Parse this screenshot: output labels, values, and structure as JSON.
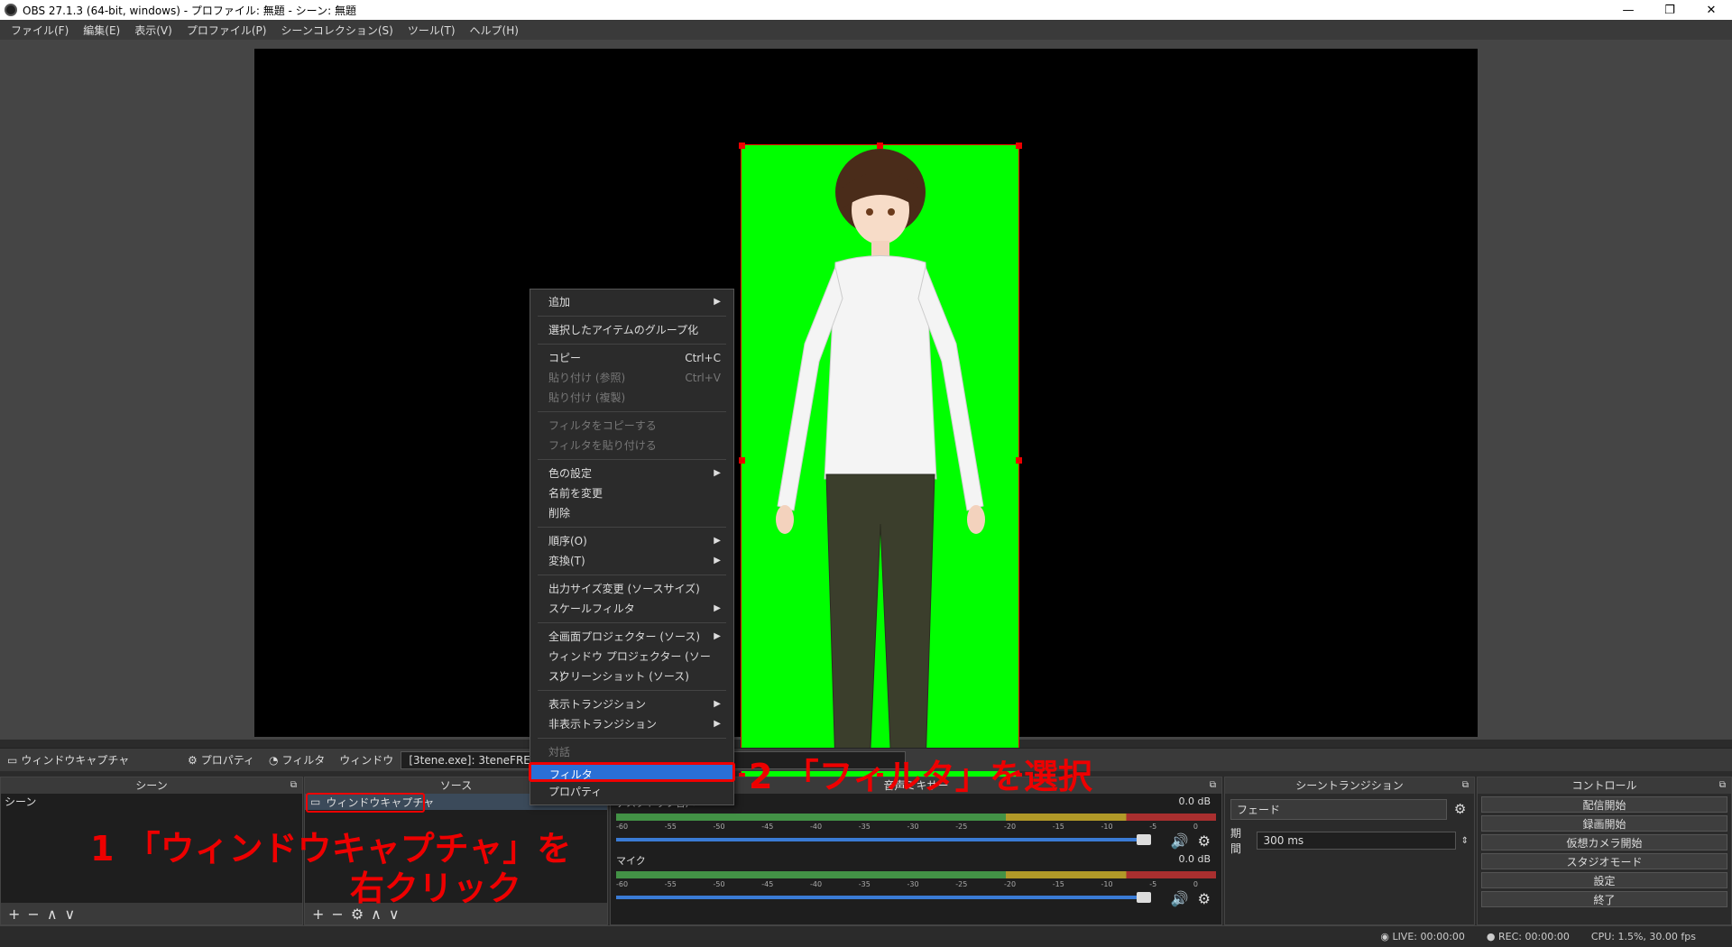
{
  "window": {
    "title": "OBS 27.1.3 (64-bit, windows) - プロファイル: 無題 - シーン: 無題",
    "minimize": "—",
    "maximize": "❐",
    "close": "✕"
  },
  "menubar": [
    "ファイル(F)",
    "編集(E)",
    "表示(V)",
    "プロファイル(P)",
    "シーンコレクション(S)",
    "ツール(T)",
    "ヘルプ(H)"
  ],
  "source_toolbar": {
    "source_name": "ウィンドウキャプチャ",
    "properties": "プロパティ",
    "filters": "フィルタ",
    "window_label": "ウィンドウ",
    "window_value": "[3tene.exe]: 3teneFREE"
  },
  "docks": {
    "scenes": {
      "title": "シーン",
      "items": [
        "シーン"
      ]
    },
    "sources": {
      "title": "ソース",
      "items": [
        "ウィンドウキャプチャ"
      ]
    },
    "mixer": {
      "title": "音声ミキサー",
      "tracks": [
        {
          "name": "デスクトップ音声",
          "db": "0.0 dB"
        },
        {
          "name": "マイク",
          "db": "0.0 dB"
        }
      ],
      "scale": [
        "-60",
        "-55",
        "-50",
        "-45",
        "-40",
        "-35",
        "-30",
        "-25",
        "-20",
        "-15",
        "-10",
        "-5",
        "0"
      ]
    },
    "transitions": {
      "title": "シーントランジション",
      "selected": "フェード",
      "duration_label": "期間",
      "duration_value": "300 ms"
    },
    "controls": {
      "title": "コントロール",
      "buttons": [
        "配信開始",
        "録画開始",
        "仮想カメラ開始",
        "スタジオモード",
        "設定",
        "終了"
      ]
    }
  },
  "statusbar": {
    "live": "LIVE: 00:00:00",
    "rec": "REC: 00:00:00",
    "cpu": "CPU: 1.5%, 30.00 fps"
  },
  "context_menu": {
    "items": [
      {
        "label": "追加",
        "shortcut": "",
        "submenu": true,
        "disabled": false
      },
      {
        "sep": true
      },
      {
        "label": "選択したアイテムのグループ化",
        "shortcut": "",
        "submenu": false,
        "disabled": false
      },
      {
        "sep": true
      },
      {
        "label": "コピー",
        "shortcut": "Ctrl+C",
        "submenu": false,
        "disabled": false
      },
      {
        "label": "貼り付け (参照)",
        "shortcut": "Ctrl+V",
        "submenu": false,
        "disabled": true
      },
      {
        "label": "貼り付け (複製)",
        "shortcut": "",
        "submenu": false,
        "disabled": true
      },
      {
        "sep": true
      },
      {
        "label": "フィルタをコピーする",
        "shortcut": "",
        "submenu": false,
        "disabled": true
      },
      {
        "label": "フィルタを貼り付ける",
        "shortcut": "",
        "submenu": false,
        "disabled": true
      },
      {
        "sep": true
      },
      {
        "label": "色の設定",
        "shortcut": "",
        "submenu": true,
        "disabled": false
      },
      {
        "label": "名前を変更",
        "shortcut": "",
        "submenu": false,
        "disabled": false
      },
      {
        "label": "削除",
        "shortcut": "",
        "submenu": false,
        "disabled": false
      },
      {
        "sep": true
      },
      {
        "label": "順序(O)",
        "shortcut": "",
        "submenu": true,
        "disabled": false
      },
      {
        "label": "変換(T)",
        "shortcut": "",
        "submenu": true,
        "disabled": false
      },
      {
        "sep": true
      },
      {
        "label": "出力サイズ変更 (ソースサイズ)",
        "shortcut": "",
        "submenu": false,
        "disabled": false
      },
      {
        "label": "スケールフィルタ",
        "shortcut": "",
        "submenu": true,
        "disabled": false
      },
      {
        "sep": true
      },
      {
        "label": "全画面プロジェクター (ソース)",
        "shortcut": "",
        "submenu": true,
        "disabled": false
      },
      {
        "label": "ウィンドウ プロジェクター (ソース)",
        "shortcut": "",
        "submenu": false,
        "disabled": false
      },
      {
        "label": "スクリーンショット (ソース)",
        "shortcut": "",
        "submenu": false,
        "disabled": false
      },
      {
        "sep": true
      },
      {
        "label": "表示トランジション",
        "shortcut": "",
        "submenu": true,
        "disabled": false
      },
      {
        "label": "非表示トランジション",
        "shortcut": "",
        "submenu": true,
        "disabled": false
      },
      {
        "sep": true
      },
      {
        "label": "対話",
        "shortcut": "",
        "submenu": false,
        "disabled": true
      },
      {
        "label": "フィルタ",
        "shortcut": "",
        "submenu": false,
        "disabled": false,
        "highlight": true
      },
      {
        "label": "プロパティ",
        "shortcut": "",
        "submenu": false,
        "disabled": false
      }
    ]
  },
  "annotations": {
    "step1_line1": "1 「ウィンドウキャプチャ」を",
    "step1_line2": "右クリック",
    "step2": "2 「フィルタ」を選択"
  },
  "colors": {
    "chroma_green": "#00ff00",
    "annotation_red": "#e00000",
    "highlight_blue": "#2a6fd6"
  }
}
